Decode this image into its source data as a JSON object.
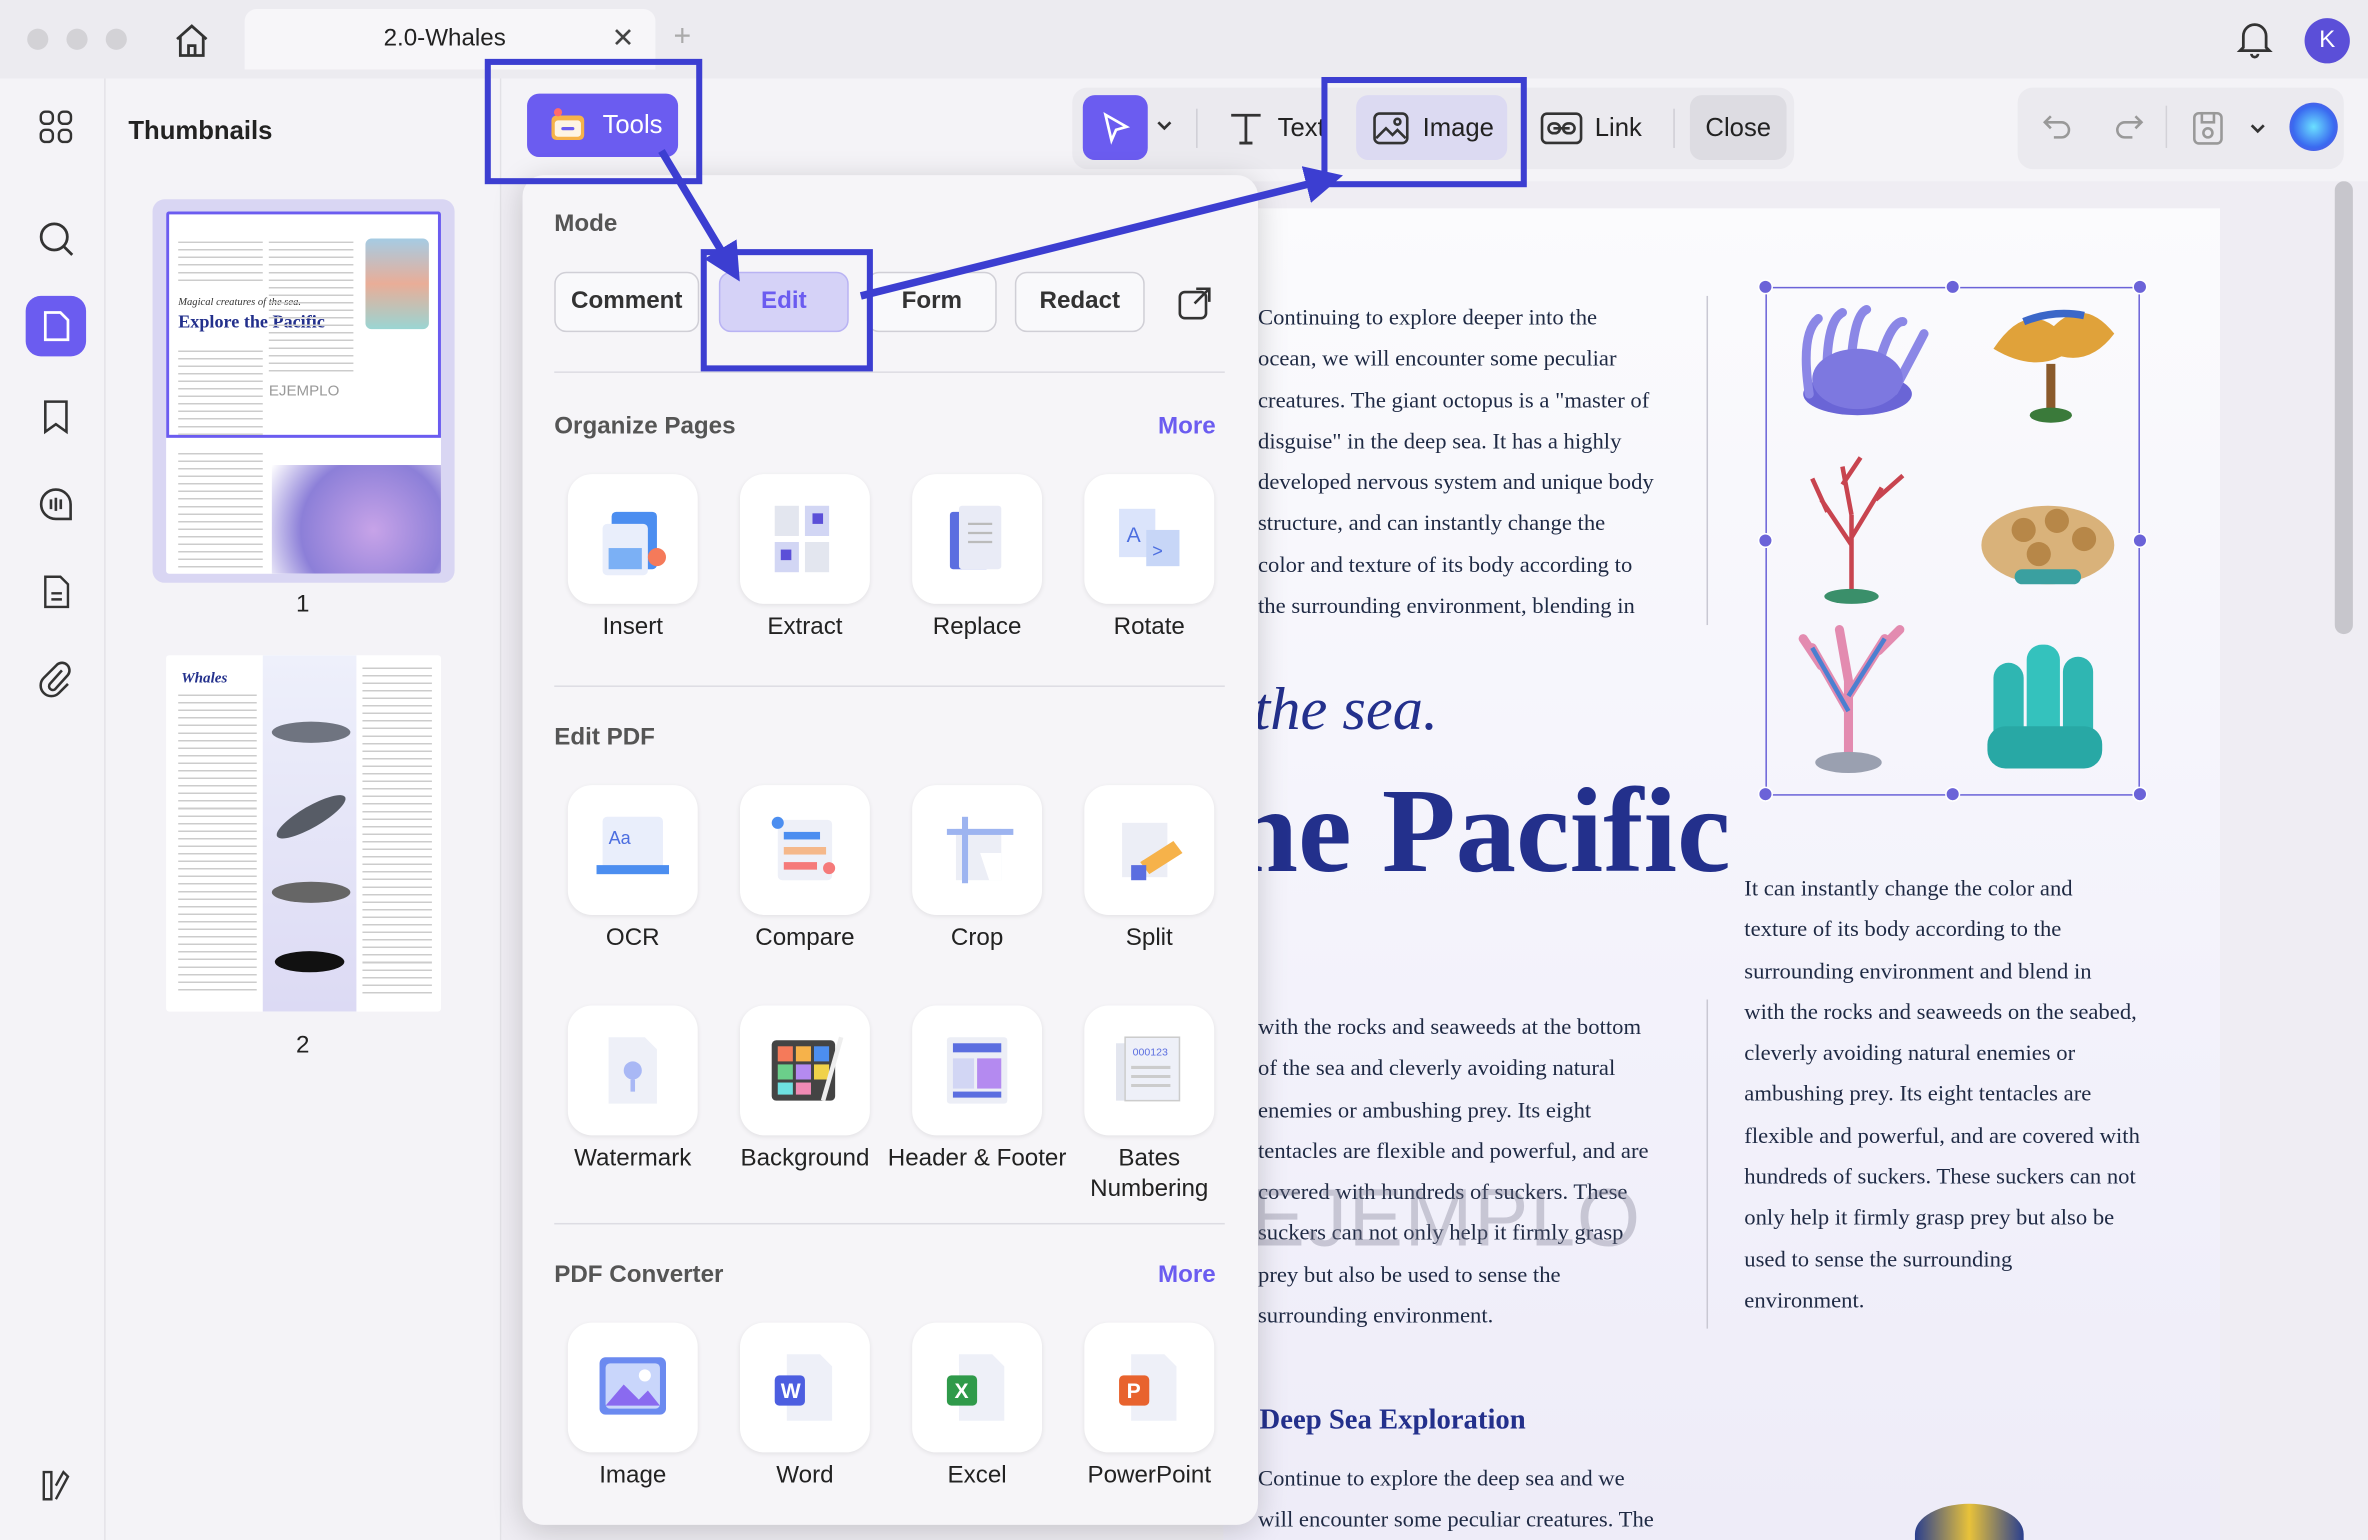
{
  "window": {
    "tab_title": "2.0-Whales",
    "avatar_letter": "K"
  },
  "thumbnails": {
    "title": "Thumbnails",
    "pages": [
      "1",
      "2"
    ],
    "page1_caption": "Magical creatures of the sea.",
    "page1_title": "Explore the Pacific",
    "page2_title": "Whales",
    "watermark": "EJEMPLO"
  },
  "toolbar": {
    "tools_label": "Tools",
    "text_label": "Text",
    "image_label": "Image",
    "link_label": "Link",
    "close_label": "Close"
  },
  "tools_menu": {
    "mode_title": "Mode",
    "modes": [
      "Comment",
      "Edit",
      "Form",
      "Redact"
    ],
    "active_mode": "Edit",
    "organize": {
      "title": "Organize Pages",
      "more": "More",
      "items": [
        "Insert",
        "Extract",
        "Replace",
        "Rotate"
      ]
    },
    "edit_pdf": {
      "title": "Edit PDF",
      "items": [
        "OCR",
        "Compare",
        "Crop",
        "Split",
        "Watermark",
        "Background",
        "Header & Footer",
        "Bates Numbering"
      ]
    },
    "converter": {
      "title": "PDF Converter",
      "more": "More",
      "items": [
        "Image",
        "Word",
        "Excel",
        "PowerPoint"
      ]
    }
  },
  "document": {
    "col1_lines": [
      "Continuing to explore deeper into the",
      "ocean, we will encounter some peculiar",
      "creatures. The giant octopus is a \"master of",
      "disguise\" in the deep sea. It has a highly",
      "developed nervous system and unique body",
      "structure, and can instantly change the",
      "color and texture of its body according to",
      "the surrounding environment, blending in"
    ],
    "sea_text": "the sea.",
    "pacific_text": "he Pacific",
    "col2_lines": [
      "with the rocks and seaweeds at the bottom",
      "of the sea and cleverly avoiding natural",
      "enemies or ambushing prey. Its eight",
      "tentacles are flexible and powerful, and are",
      "covered with hundreds of suckers. These",
      "suckers can not only help it firmly grasp",
      "prey but also be used to sense the",
      "surrounding environment."
    ],
    "col3_lines": [
      "It can instantly change the color and",
      "texture of its body according to the",
      "surrounding environment and blend in",
      "with the rocks and seaweeds on the seabed,",
      "cleverly avoiding natural enemies or",
      "ambushing prey. Its eight tentacles are",
      "flexible and powerful, and are covered with",
      "hundreds of suckers. These suckers can not",
      "only help it firmly grasp prey but also be",
      "used to sense the surrounding",
      "environment."
    ],
    "deep_heading": "Deep Sea Exploration",
    "deep_lines": [
      "Continue to explore the deep sea and we",
      "will encounter some peculiar creatures. The"
    ],
    "watermark": "EJEMPLO"
  },
  "colors": {
    "accent": "#6b5cf0",
    "annotation": "#3c3ed1",
    "title_blue": "#23308c"
  }
}
